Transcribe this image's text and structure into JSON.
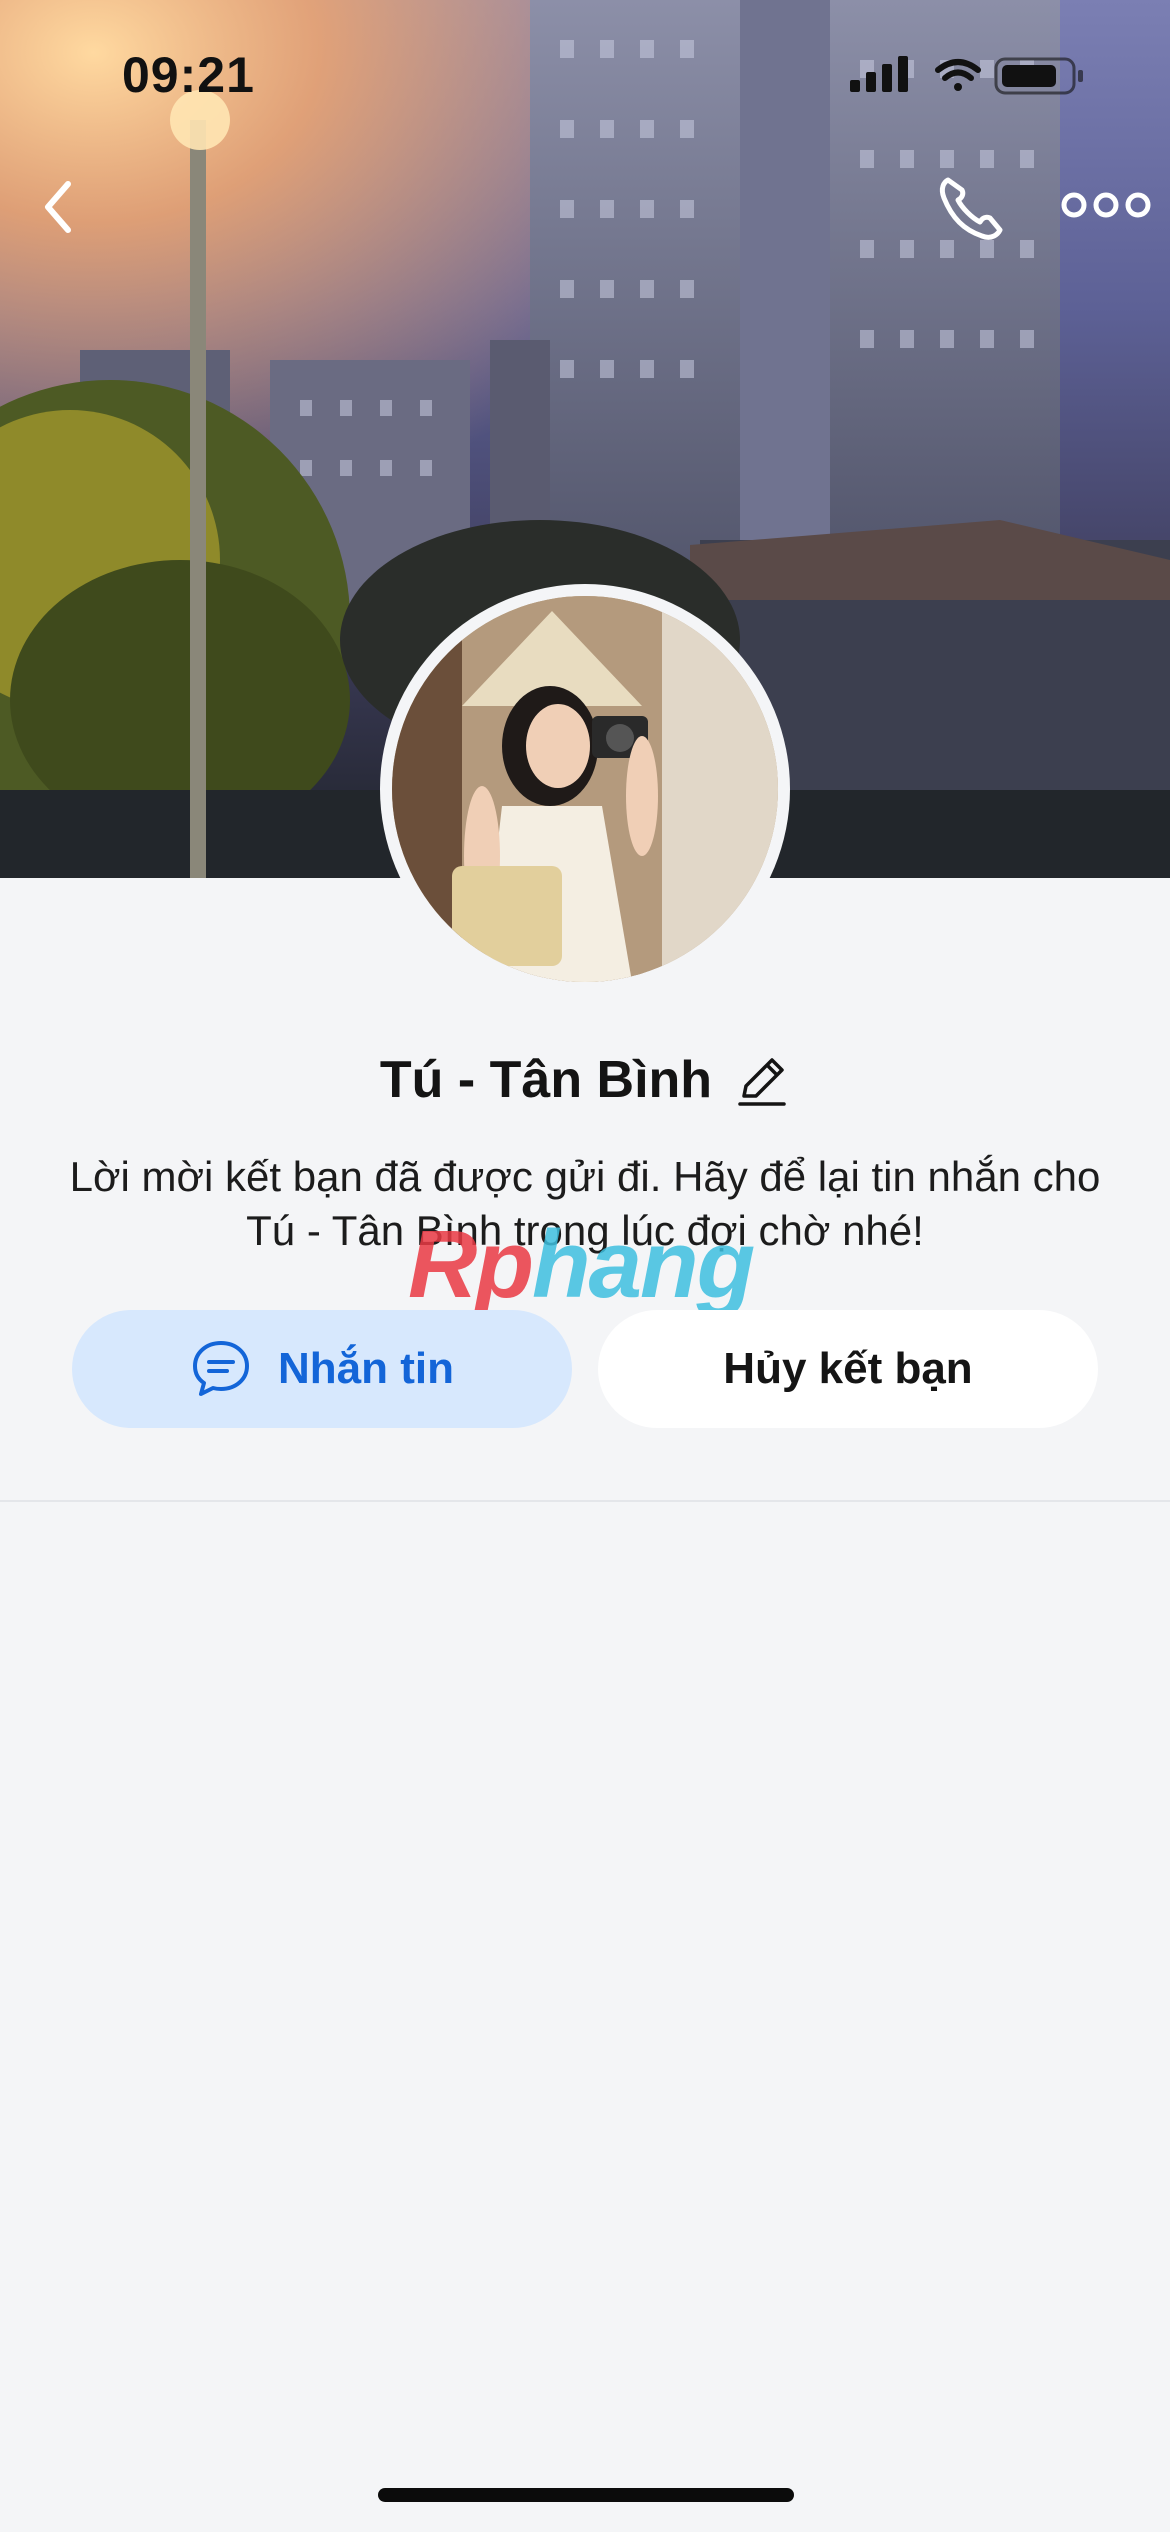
{
  "status_bar": {
    "time": "09:21",
    "icons": [
      "signal-icon",
      "wifi-icon",
      "battery-icon"
    ]
  },
  "nav": {
    "icons": [
      "chevron-left-icon",
      "phone-icon",
      "more-horizontal-icon"
    ]
  },
  "profile": {
    "name": "Tú - Tân Bình",
    "description": "Lời mời kết bạn đã được gửi đi. Hãy để lại tin nhắn cho Tú - Tân Bình trong lúc đợi chờ nhé!"
  },
  "watermark": {
    "head": "Rp",
    "tail": "hang"
  },
  "actions": {
    "message_label": "Nhắn tin",
    "cancel_label": "Hủy kết bạn"
  },
  "colors": {
    "accent": "#1365d8",
    "accent_bg": "#d7e8fd",
    "page_bg": "#f4f5f7"
  }
}
